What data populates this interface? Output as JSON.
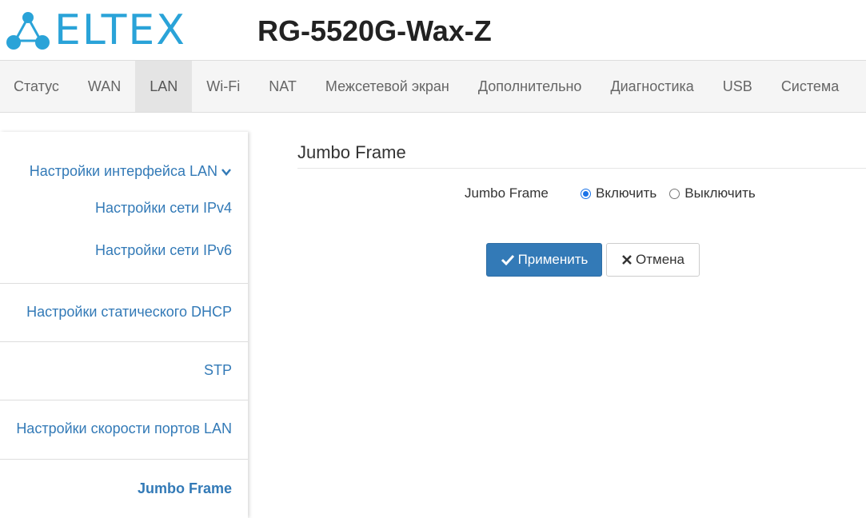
{
  "header": {
    "logo_text": "ELTEX",
    "model": "RG-5520G-Wax-Z"
  },
  "nav": {
    "items": [
      {
        "label": "Статус",
        "active": false
      },
      {
        "label": "WAN",
        "active": false
      },
      {
        "label": "LAN",
        "active": true
      },
      {
        "label": "Wi-Fi",
        "active": false
      },
      {
        "label": "NAT",
        "active": false
      },
      {
        "label": "Межсетевой экран",
        "active": false
      },
      {
        "label": "Дополнительно",
        "active": false
      },
      {
        "label": "Диагностика",
        "active": false
      },
      {
        "label": "USB",
        "active": false
      },
      {
        "label": "Система",
        "active": false
      }
    ]
  },
  "sidebar": {
    "group_interface": "Настройки интерфейса LAN",
    "ipv4": "Настройки сети IPv4",
    "ipv6": "Настройки сети IPv6",
    "static_dhcp": "Настройки статического DHCP",
    "stp": "STP",
    "port_speed": "Настройки скорости портов LAN",
    "jumbo": "Jumbo Frame"
  },
  "main": {
    "title": "Jumbo Frame",
    "field_label": "Jumbo Frame",
    "option_on": "Включить",
    "option_off": "Выключить",
    "selected": "on",
    "apply_label": "Применить",
    "cancel_label": "Отмена"
  },
  "colors": {
    "brand": "#2aa3d8",
    "link": "#337ab7",
    "primary_button": "#337ab7"
  }
}
